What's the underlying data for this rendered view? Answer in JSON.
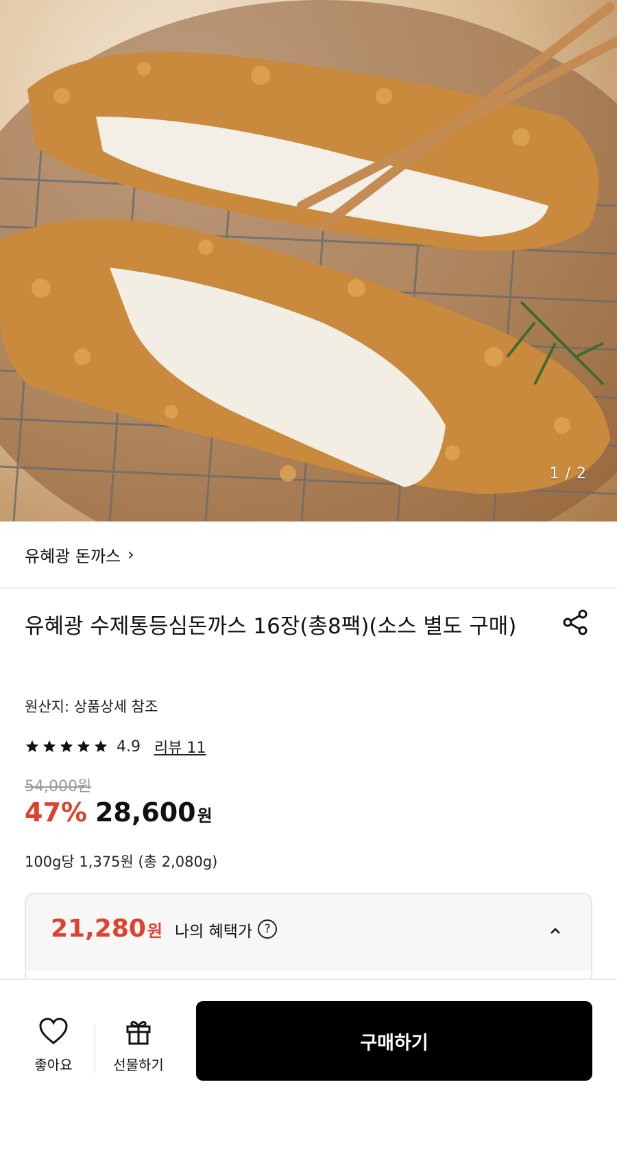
{
  "hero": {
    "counter": "1 / 2"
  },
  "brand": {
    "name": "유혜광 돈까스",
    "chevron": "›"
  },
  "product": {
    "title": "유혜광 수제통등심돈까스 16장(총8팩)(소스 별도 구매)",
    "origin": "원산지: 상품상세 참조",
    "rating": "4.9",
    "rating_stars": 5,
    "reviews": "리뷰 11",
    "original_price": "54,000원",
    "discount": "47%",
    "price": "28,600",
    "price_unit": "원",
    "unit_price": "100g당 1,375원 (총 2,080g)"
  },
  "benefit": {
    "price": "21,280",
    "price_unit": "원",
    "label": "나의 혜택가",
    "help": "?"
  },
  "bottom_bar": {
    "like_label": "좋아요",
    "gift_label": "선물하기",
    "buy_label": "구매하기"
  },
  "colors": {
    "accent": "#e0412d",
    "buy_button": "#000000"
  },
  "icons": [
    "share-icon",
    "star-icon",
    "help-icon",
    "chevron-up-icon",
    "heart-icon",
    "gift-icon"
  ]
}
